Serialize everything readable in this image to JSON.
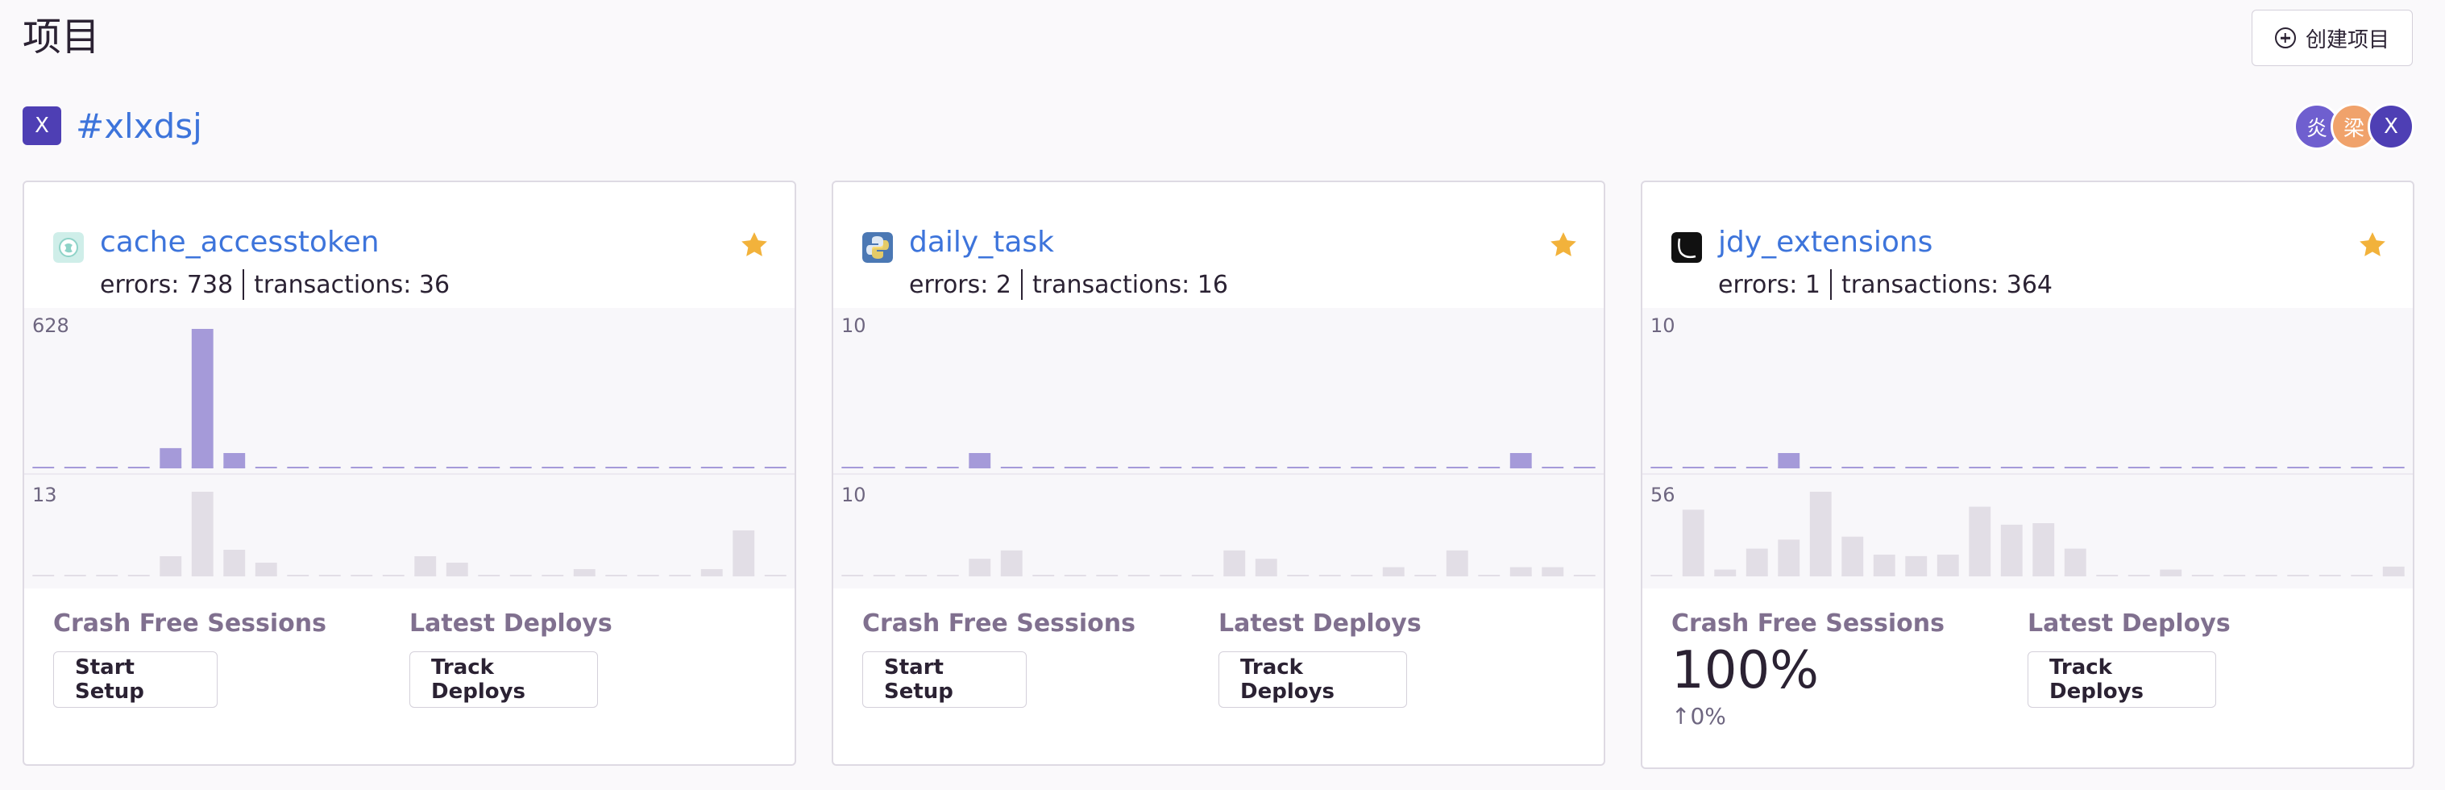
{
  "page": {
    "title": "项目",
    "create_button": "创建项目"
  },
  "team": {
    "avatar": "X",
    "name": "#xlxdsj",
    "members": [
      {
        "initial": "炎",
        "color": "#6f5fcf"
      },
      {
        "initial": "梁",
        "color": "#f0a26b"
      },
      {
        "initial": "X",
        "color": "#4e3fb4"
      }
    ]
  },
  "colors": {
    "accent": "#3d74db",
    "bar_errors": "#a59ad9",
    "bar_transactions": "#e2dee6",
    "star": "#f2b23b"
  },
  "projects": [
    {
      "name": "cache_accesstoken",
      "icon": "cache-app-icon",
      "starred": true,
      "errors_text": "errors: 738",
      "transactions_text": "transactions: 36",
      "errors_max_label": "628",
      "transactions_max_label": "13",
      "errors_series": [
        0,
        0,
        0,
        0,
        88,
        628,
        28,
        0,
        0,
        0,
        0,
        0,
        0,
        0,
        0,
        0,
        0,
        0,
        0,
        0,
        0,
        0,
        0,
        0
      ],
      "transactions_series": [
        0,
        0,
        0,
        0,
        3,
        13,
        4,
        2,
        0,
        0,
        0,
        0,
        3,
        2,
        0,
        0,
        0,
        1,
        0,
        0,
        0,
        1,
        7,
        0
      ],
      "crash_free_label": "Crash Free Sessions",
      "crash_free_button": "Start Setup",
      "deploys_label": "Latest Deploys",
      "deploys_button": "Track Deploys"
    },
    {
      "name": "daily_task",
      "icon": "python-icon",
      "starred": true,
      "errors_text": "errors: 2",
      "transactions_text": "transactions: 16",
      "errors_max_label": "10",
      "transactions_max_label": "10",
      "errors_series": [
        0,
        0,
        0,
        0,
        1,
        0,
        0,
        0,
        0,
        0,
        0,
        0,
        0,
        0,
        0,
        0,
        0,
        0,
        0,
        0,
        0,
        1,
        0,
        0
      ],
      "transactions_series": [
        0,
        0,
        0,
        0,
        2,
        3,
        0,
        0,
        0,
        0,
        0,
        0,
        3,
        2,
        0,
        0,
        0,
        1,
        0,
        3,
        0,
        1,
        1,
        0
      ],
      "crash_free_label": "Crash Free Sessions",
      "crash_free_button": "Start Setup",
      "deploys_label": "Latest Deploys",
      "deploys_button": "Track Deploys"
    },
    {
      "name": "jdy_extensions",
      "icon": "terminal-icon",
      "starred": true,
      "errors_text": "errors: 1",
      "transactions_text": "transactions: 364",
      "errors_max_label": "10",
      "transactions_max_label": "56",
      "errors_series": [
        0,
        0,
        0,
        0,
        1,
        0,
        0,
        0,
        0,
        0,
        0,
        0,
        0,
        0,
        0,
        0,
        0,
        0,
        0,
        0,
        0,
        0,
        0,
        0
      ],
      "transactions_series": [
        0,
        44,
        4,
        18,
        24,
        56,
        26,
        14,
        13,
        14,
        46,
        34,
        35,
        18,
        0,
        0,
        4,
        0,
        0,
        0,
        0,
        0,
        0,
        6
      ],
      "crash_free_label": "Crash Free Sessions",
      "crash_free_value": "100%",
      "crash_free_change": "↑0%",
      "deploys_label": "Latest Deploys",
      "deploys_button": "Track Deploys"
    }
  ]
}
